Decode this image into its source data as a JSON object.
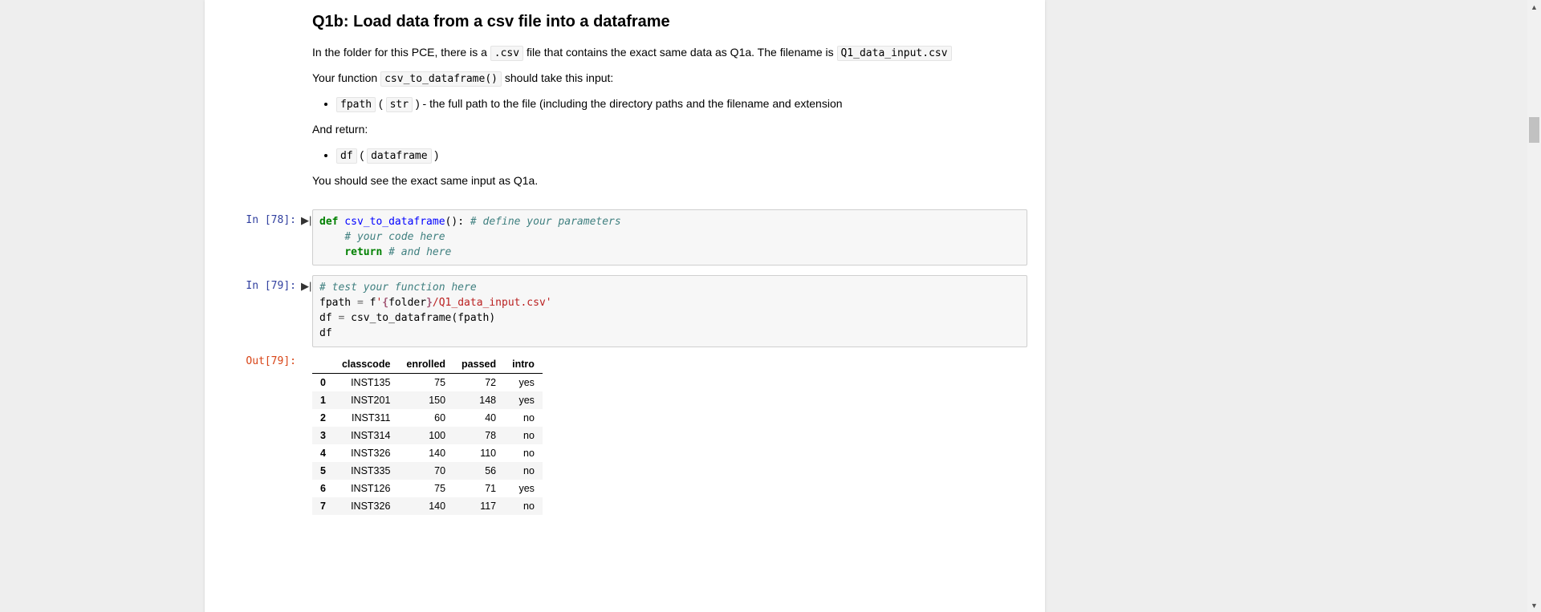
{
  "heading": "Q1b: Load data from a csv file into a dataframe",
  "p1_pre": "In the folder for this PCE, there is a ",
  "p1_code1": ".csv",
  "p1_mid": " file that contains the exact same data as Q1a. The filename is ",
  "p1_code2": "Q1_data_input.csv",
  "p2_pre": "Your function ",
  "p2_code": "csv_to_dataframe()",
  "p2_post": " should take this input:",
  "li1_code1": "fpath",
  "li1_mid": " ( ",
  "li1_code2": "str",
  "li1_post": " ) - the full path to the file (including the directory paths and the filename and extension",
  "p3": "And return:",
  "li2_code1": "df",
  "li2_mid": " ( ",
  "li2_code2": "dataframe",
  "li2_post": " )",
  "p4": "You should see the exact same input as Q1a.",
  "in78_label": "In [78]:",
  "in79_label": "In [79]:",
  "out79_label": "Out[79]:",
  "run_glyph": "▶|",
  "code78": {
    "l1_kw": "def",
    "l1_fn": " csv_to_dataframe",
    "l1_rest": "(): ",
    "l1_cm": "# define your parameters",
    "l2_cm": "# your code here",
    "l3_kw": "return",
    "l3_sp": " ",
    "l3_cm": "# and here"
  },
  "code79": {
    "l1_cm": "# test your function here",
    "l2_a": "fpath ",
    "l2_op": "=",
    "l2_b": " f",
    "l2_s1": "'",
    "l2_interp_open": "{",
    "l2_interp_var": "folder",
    "l2_interp_close": "}",
    "l2_s2": "/Q1_data_input.csv'",
    "l3_a": "df ",
    "l3_op": "=",
    "l3_b": " csv_to_dataframe(fpath)",
    "l4": "df"
  },
  "df": {
    "columns": [
      "classcode",
      "enrolled",
      "passed",
      "intro"
    ],
    "index": [
      "0",
      "1",
      "2",
      "3",
      "4",
      "5",
      "6",
      "7"
    ],
    "rows": [
      [
        "INST135",
        "75",
        "72",
        "yes"
      ],
      [
        "INST201",
        "150",
        "148",
        "yes"
      ],
      [
        "INST311",
        "60",
        "40",
        "no"
      ],
      [
        "INST314",
        "100",
        "78",
        "no"
      ],
      [
        "INST326",
        "140",
        "110",
        "no"
      ],
      [
        "INST335",
        "70",
        "56",
        "no"
      ],
      [
        "INST126",
        "75",
        "71",
        "yes"
      ],
      [
        "INST326",
        "140",
        "117",
        "no"
      ]
    ]
  }
}
